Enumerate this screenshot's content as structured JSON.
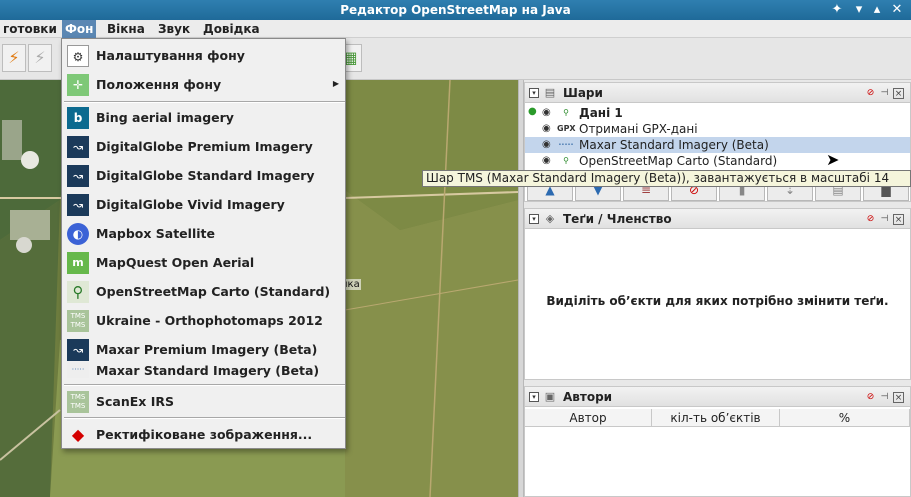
{
  "window": {
    "title": "Редактор OpenStreetMap на Java"
  },
  "menubar": {
    "items": [
      "готовки",
      "Фон",
      "Вікна",
      "Звук",
      "Довідка"
    ]
  },
  "background_menu": {
    "items": [
      {
        "label": "Налаштування фону",
        "icon": "settings-icon",
        "color": "#ffffff"
      },
      {
        "label": "Положення фону",
        "icon": "offset-icon",
        "color": "#7ec877"
      },
      {
        "label": "Bing aerial imagery",
        "icon": "bing-icon",
        "color": "#0c6a8f"
      },
      {
        "label": "DigitalGlobe Premium Imagery",
        "icon": "digitalglobe-icon",
        "color": "#1b3a5a"
      },
      {
        "label": "DigitalGlobe Standard Imagery",
        "icon": "digitalglobe-icon",
        "color": "#1b3a5a"
      },
      {
        "label": "DigitalGlobe Vivid Imagery",
        "icon": "digitalglobe-icon",
        "color": "#1b3a5a"
      },
      {
        "label": "Mapbox Satellite",
        "icon": "mapbox-icon",
        "color": "#3b62d6"
      },
      {
        "label": "MapQuest Open Aerial",
        "icon": "mapquest-icon",
        "color": "#66b84b"
      },
      {
        "label": "OpenStreetMap Carto (Standard)",
        "icon": "magnifier-icon",
        "color": "#dfe8d5"
      },
      {
        "label": "Ukraine - Orthophotomaps 2012",
        "icon": "tms-icon",
        "color": "#a9c49a"
      },
      {
        "label": "Maxar Premium Imagery (Beta)",
        "icon": "maxar-icon",
        "color": "#1b3a5a"
      },
      {
        "label": "Maxar Standard Imagery (Beta)",
        "icon": "maxar-icon",
        "color": "#eeeeee"
      },
      {
        "label": "ScanEx IRS",
        "icon": "tms-icon",
        "color": "#a9c49a"
      },
      {
        "label": "Ректифіковане зображення...",
        "icon": "rectify-icon",
        "color": "#d40000"
      }
    ]
  },
  "map": {
    "label": "нка"
  },
  "layers_panel": {
    "title": "Шари",
    "layers": [
      {
        "name": "Дані 1",
        "icon": "data-layer-icon",
        "active": true
      },
      {
        "name": "Отримані GPX-дані",
        "icon_text": "GPX"
      },
      {
        "name": "Maxar Standard Imagery (Beta)",
        "icon_text": "·····",
        "selected": true
      },
      {
        "name": "OpenStreetMap Carto (Standard)",
        "icon": "magnifier-icon"
      }
    ],
    "tooltip": "Шар TMS (Maxar Standard Imagery (Beta)), завантажується в масштабі 14"
  },
  "tags_panel": {
    "title": "Теґи / Членство",
    "message": "Виділіть об’єкти для яких потрібно змінити теґи."
  },
  "authors_panel": {
    "title": "Автори",
    "columns": [
      "Автор",
      "кіл-ть об’єктів",
      "%"
    ]
  },
  "colors": {
    "titlebar": "#2574a5",
    "menu_highlight": "#5b87b3",
    "selection": "#c3d5ec"
  }
}
